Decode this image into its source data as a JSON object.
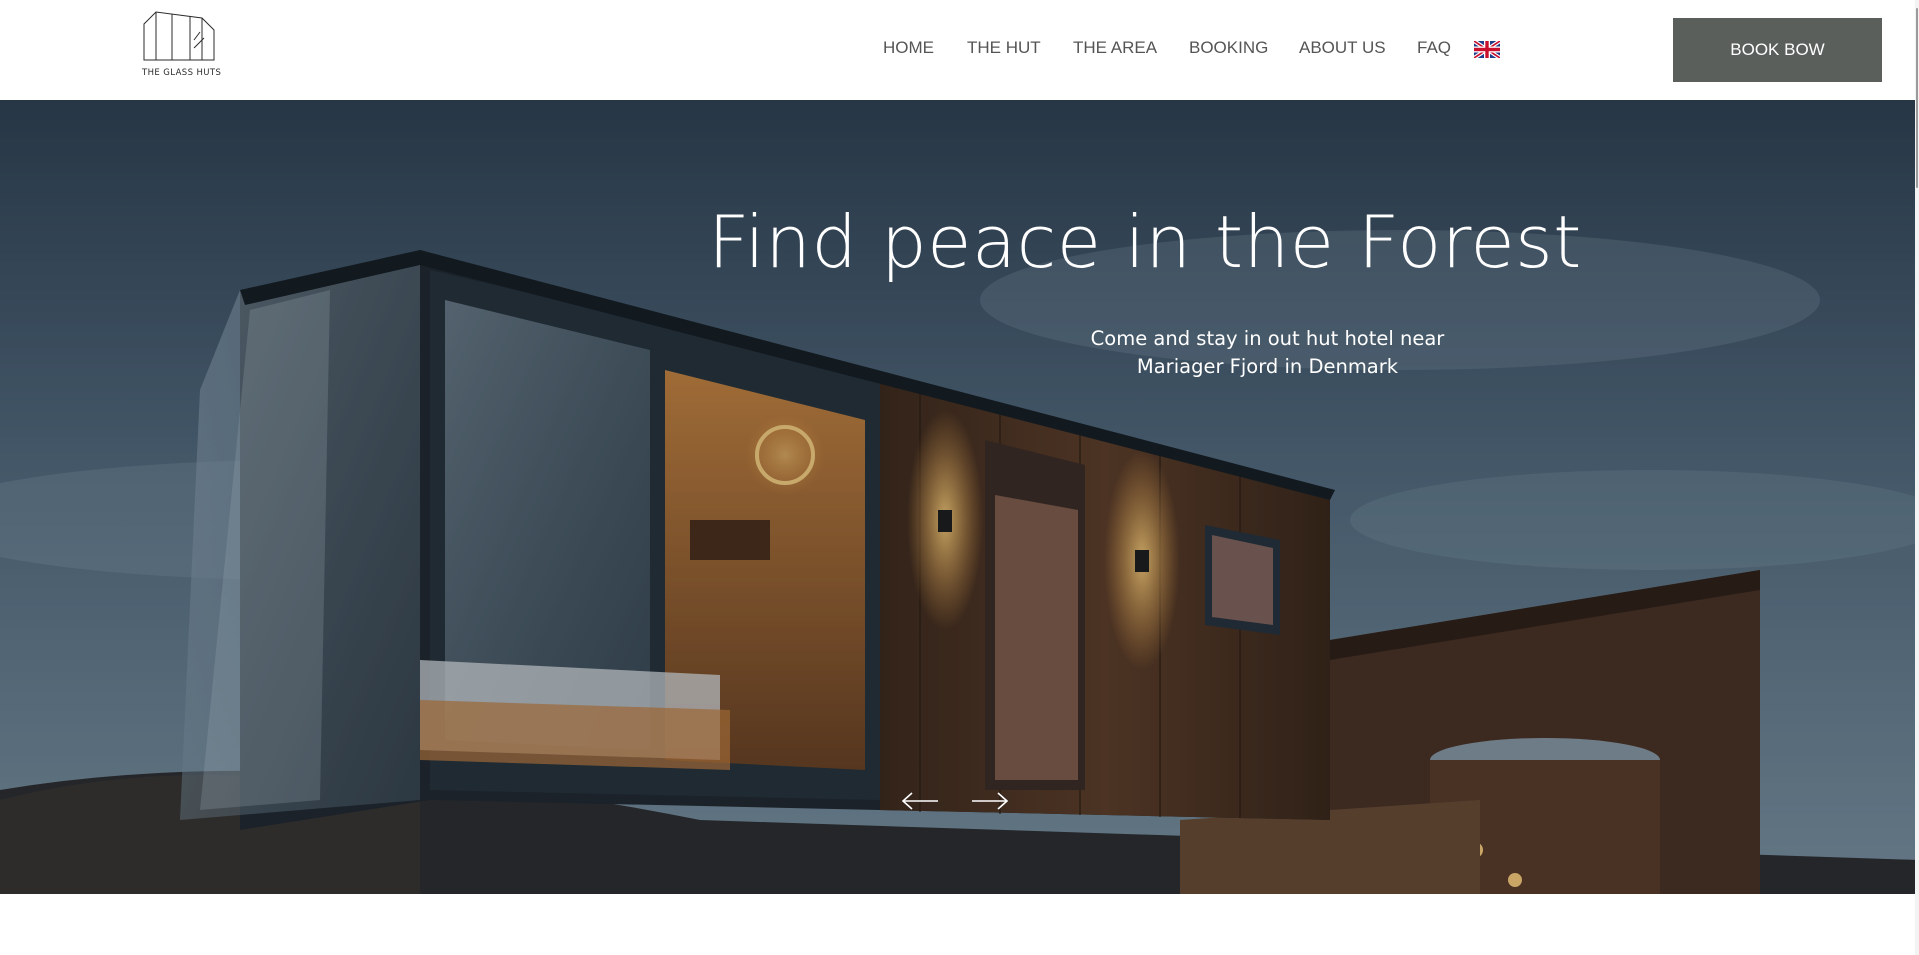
{
  "brand": {
    "name": "THE GLASS HUTS"
  },
  "nav": {
    "items": [
      {
        "label": "HOME"
      },
      {
        "label": "THE HUT"
      },
      {
        "label": "THE AREA"
      },
      {
        "label": "BOOKING"
      },
      {
        "label": "ABOUT US"
      },
      {
        "label": "FAQ"
      }
    ],
    "language_icon": "uk-flag-icon"
  },
  "header": {
    "cta_label": "BOOK BOW",
    "cta_color": "#5b5f5c"
  },
  "hero": {
    "title": "Find peace in the Forest",
    "subtitle_line1": "Come and stay in out hut hotel near",
    "subtitle_line2": "Mariager Fjord in Denmark",
    "prev_icon": "arrow-left-icon",
    "next_icon": "arrow-right-icon"
  },
  "colors": {
    "sky_top": "#35485a",
    "sky_bottom": "#6f8799",
    "wood": "#5a3a26",
    "warm_light": "#f2a64a",
    "nav_text": "#555555"
  }
}
